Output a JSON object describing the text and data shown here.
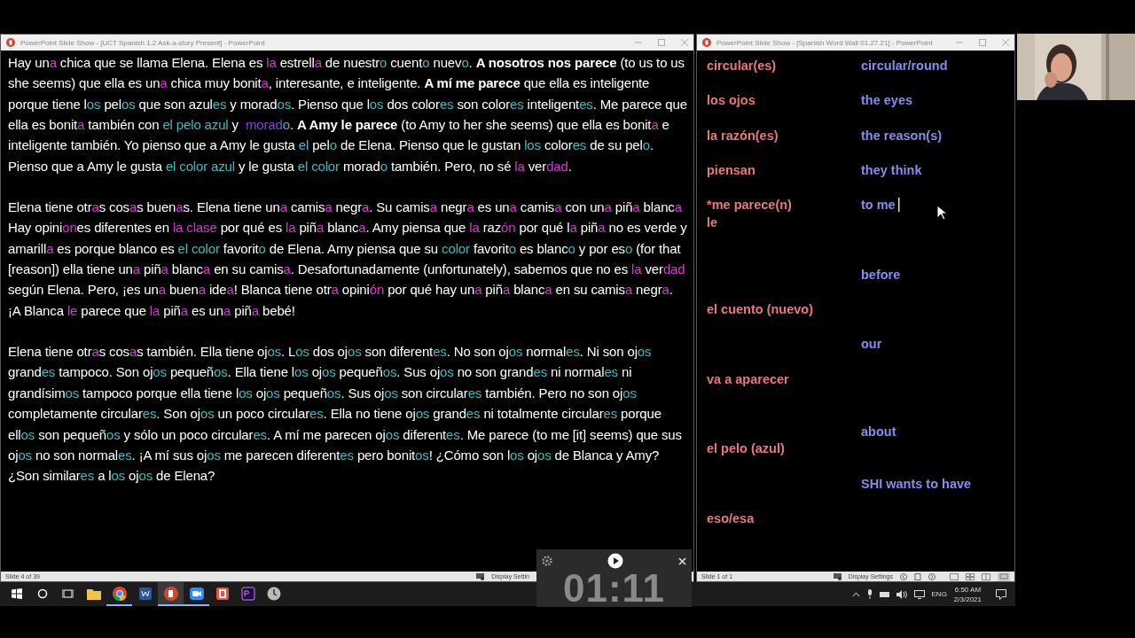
{
  "story_window": {
    "title": "PowerPoint Slide Show - [UCT Spanish 1.2 Ask-a-story Present] - PowerPoint",
    "paragraphs": [
      [
        {
          "text": "Hay un"
        },
        {
          "text": "a",
          "color": "#d63bd0"
        },
        {
          "text": " chica que se llama Elena. Elena es "
        },
        {
          "text": "la",
          "color": "#d63bd0"
        },
        {
          "text": " estrell"
        },
        {
          "text": "a",
          "color": "#d63bd0"
        },
        {
          "text": " de nuestr"
        },
        {
          "text": "o",
          "color": "#3fbcc0"
        },
        {
          "text": " cuent"
        },
        {
          "text": "o",
          "color": "#3fbcc0"
        },
        {
          "text": " nuev"
        },
        {
          "text": "o",
          "color": "#3fbcc0"
        },
        {
          "text": ". **A nosotros nos parece** (to us to us she seems) que ella es un"
        },
        {
          "text": "a",
          "color": "#d63bd0"
        },
        {
          "text": " chica muy bonit"
        },
        {
          "text": "a",
          "color": "#d63bd0"
        },
        {
          "text": ", interesante, e inteligente. **A mí me parece** que ella es inteligente porque tiene l"
        },
        {
          "text": "os",
          "color": "#3fbcc0"
        },
        {
          "text": " pel"
        },
        {
          "text": "os",
          "color": "#3fbcc0"
        },
        {
          "text": " que son azul"
        },
        {
          "text": "es",
          "color": "#3fbcc0"
        },
        {
          "text": " y morad"
        },
        {
          "text": "os",
          "color": "#3fbcc0"
        },
        {
          "text": ". Pienso que l"
        },
        {
          "text": "os",
          "color": "#3fbcc0"
        },
        {
          "text": " dos color"
        },
        {
          "text": "es",
          "color": "#3fbcc0"
        },
        {
          "text": " son color"
        },
        {
          "text": "es",
          "color": "#3fbcc0"
        },
        {
          "text": " inteligent"
        },
        {
          "text": "es",
          "color": "#3fbcc0"
        },
        {
          "text": ". Me parece que ella es bonit"
        },
        {
          "text": "a",
          "color": "#d63bd0"
        },
        {
          "text": " también con "
        },
        {
          "text": "el pelo azul",
          "color": "#3fbcc0"
        },
        {
          "text": " y  "
        },
        {
          "text": "morad",
          "color": "#8b3fe0"
        },
        {
          "text": "o",
          "color": "#3fbcc0"
        },
        {
          "text": ". **A Amy le parece** (to Amy to her she seems) que ella es bonit"
        },
        {
          "text": "a",
          "color": "#d63bd0"
        },
        {
          "text": " e inteligente también. Yo pienso que a Amy le gusta "
        },
        {
          "text": "el",
          "color": "#3fbcc0"
        },
        {
          "text": " pel"
        },
        {
          "text": "o",
          "color": "#3fbcc0"
        },
        {
          "text": " de Elena. Pienso que le gustan "
        },
        {
          "text": "los",
          "color": "#3fbcc0"
        },
        {
          "text": " color"
        },
        {
          "text": "es",
          "color": "#3fbcc0"
        },
        {
          "text": " de su pel"
        },
        {
          "text": "o",
          "color": "#3fbcc0"
        },
        {
          "text": ". Pienso que a Amy le gusta "
        },
        {
          "text": "el color azul",
          "color": "#3fbcc0"
        },
        {
          "text": " y le gusta "
        },
        {
          "text": "el color",
          "color": "#3fbcc0"
        },
        {
          "text": " morad"
        },
        {
          "text": "o",
          "color": "#3fbcc0"
        },
        {
          "text": " también. Pero, no sé "
        },
        {
          "text": "la",
          "color": "#d63bd0"
        },
        {
          "text": " ver"
        },
        {
          "text": "dad",
          "color": "#d63bd0"
        },
        {
          "text": "."
        }
      ],
      [
        {
          "text": "Elena tiene otr"
        },
        {
          "text": "a",
          "color": "#d63bd0"
        },
        {
          "text": "s cos"
        },
        {
          "text": "a",
          "color": "#d63bd0"
        },
        {
          "text": "s buen"
        },
        {
          "text": "a",
          "color": "#d63bd0"
        },
        {
          "text": "s. Elena tiene un"
        },
        {
          "text": "a",
          "color": "#d63bd0"
        },
        {
          "text": " camis"
        },
        {
          "text": "a",
          "color": "#d63bd0"
        },
        {
          "text": " negr"
        },
        {
          "text": "a",
          "color": "#d63bd0"
        },
        {
          "text": ". Su camis"
        },
        {
          "text": "a",
          "color": "#d63bd0"
        },
        {
          "text": " negr"
        },
        {
          "text": "a",
          "color": "#d63bd0"
        },
        {
          "text": " es un"
        },
        {
          "text": "a",
          "color": "#d63bd0"
        },
        {
          "text": " camis"
        },
        {
          "text": "a",
          "color": "#d63bd0"
        },
        {
          "text": " con un"
        },
        {
          "text": "a",
          "color": "#d63bd0"
        },
        {
          "text": " piñ"
        },
        {
          "text": "a",
          "color": "#d63bd0"
        },
        {
          "text": " blanc"
        },
        {
          "text": "a",
          "color": "#d63bd0"
        },
        {
          "text": " Hay opini"
        },
        {
          "text": "on",
          "color": "#d63bd0"
        },
        {
          "text": "es diferentes en "
        },
        {
          "text": "la clase",
          "color": "#d63bd0"
        },
        {
          "text": " por qué es "
        },
        {
          "text": "la",
          "color": "#d63bd0"
        },
        {
          "text": " piñ"
        },
        {
          "text": "a",
          "color": "#d63bd0"
        },
        {
          "text": " blanc"
        },
        {
          "text": "a",
          "color": "#d63bd0"
        },
        {
          "text": ". Amy piensa que "
        },
        {
          "text": "la",
          "color": "#d63bd0"
        },
        {
          "text": " raz"
        },
        {
          "text": "ón",
          "color": "#d63bd0"
        },
        {
          "text": " por qué l"
        },
        {
          "text": "a",
          "color": "#d63bd0"
        },
        {
          "text": " piñ"
        },
        {
          "text": "a",
          "color": "#d63bd0"
        },
        {
          "text": " no es verde y amarill"
        },
        {
          "text": "a",
          "color": "#d63bd0"
        },
        {
          "text": " es porque blanco es "
        },
        {
          "text": "el color",
          "color": "#3fbcc0"
        },
        {
          "text": " favorit"
        },
        {
          "text": "o",
          "color": "#3fbcc0"
        },
        {
          "text": " de Elena. Amy piensa que su "
        },
        {
          "text": "color",
          "color": "#3fbcc0"
        },
        {
          "text": " favorit"
        },
        {
          "text": "o",
          "color": "#3fbcc0"
        },
        {
          "text": " es blanc"
        },
        {
          "text": "o",
          "color": "#3fbcc0"
        },
        {
          "text": " y por es"
        },
        {
          "text": "o",
          "color": "#3fbcc0"
        },
        {
          "text": " (for that [reason]) ella tiene un"
        },
        {
          "text": "a",
          "color": "#d63bd0"
        },
        {
          "text": " piñ"
        },
        {
          "text": "a",
          "color": "#d63bd0"
        },
        {
          "text": " blanc"
        },
        {
          "text": "a",
          "color": "#d63bd0"
        },
        {
          "text": " en su camis"
        },
        {
          "text": "a",
          "color": "#d63bd0"
        },
        {
          "text": ". Desafortunadamente (unfortunately), sabemos que no es "
        },
        {
          "text": "la",
          "color": "#d63bd0"
        },
        {
          "text": " ver"
        },
        {
          "text": "dad",
          "color": "#d63bd0"
        },
        {
          "text": " según Elena. Pero, ¡es un"
        },
        {
          "text": "a",
          "color": "#d63bd0"
        },
        {
          "text": " buen"
        },
        {
          "text": "a",
          "color": "#d63bd0"
        },
        {
          "text": " ide"
        },
        {
          "text": "a",
          "color": "#d63bd0"
        },
        {
          "text": "! Blanca tiene otr"
        },
        {
          "text": "a",
          "color": "#d63bd0"
        },
        {
          "text": " opini"
        },
        {
          "text": "ón",
          "color": "#d63bd0"
        },
        {
          "text": " por qué hay un"
        },
        {
          "text": "a",
          "color": "#d63bd0"
        },
        {
          "text": " piñ"
        },
        {
          "text": "a",
          "color": "#d63bd0"
        },
        {
          "text": " blanc"
        },
        {
          "text": "a",
          "color": "#d63bd0"
        },
        {
          "text": " en su camis"
        },
        {
          "text": "a",
          "color": "#d63bd0"
        },
        {
          "text": " negr"
        },
        {
          "text": "a",
          "color": "#d63bd0"
        },
        {
          "text": ". ¡A Blanca "
        },
        {
          "text": "le",
          "color": "#d63bd0"
        },
        {
          "text": " parece que "
        },
        {
          "text": "la",
          "color": "#d63bd0"
        },
        {
          "text": " piñ"
        },
        {
          "text": "a",
          "color": "#d63bd0"
        },
        {
          "text": " es un"
        },
        {
          "text": "a",
          "color": "#d63bd0"
        },
        {
          "text": " piñ"
        },
        {
          "text": "a",
          "color": "#d63bd0"
        },
        {
          "text": " bebé!"
        }
      ],
      [
        {
          "text": "Elena tiene otr"
        },
        {
          "text": "a",
          "color": "#d63bd0"
        },
        {
          "text": "s cos"
        },
        {
          "text": "a",
          "color": "#d63bd0"
        },
        {
          "text": "s también. Ella tiene oj"
        },
        {
          "text": "os",
          "color": "#3fbcc0"
        },
        {
          "text": ". L"
        },
        {
          "text": "os",
          "color": "#3fbcc0"
        },
        {
          "text": " dos oj"
        },
        {
          "text": "os",
          "color": "#3fbcc0"
        },
        {
          "text": " son diferent"
        },
        {
          "text": "es",
          "color": "#3fbcc0"
        },
        {
          "text": ". No son oj"
        },
        {
          "text": "os",
          "color": "#3fbcc0"
        },
        {
          "text": " normal"
        },
        {
          "text": "es",
          "color": "#3fbcc0"
        },
        {
          "text": ". Ni son oj"
        },
        {
          "text": "os",
          "color": "#3fbcc0"
        },
        {
          "text": " grand"
        },
        {
          "text": "es",
          "color": "#3fbcc0"
        },
        {
          "text": " tampoco. Son oj"
        },
        {
          "text": "os",
          "color": "#3fbcc0"
        },
        {
          "text": " pequeñ"
        },
        {
          "text": "os",
          "color": "#3fbcc0"
        },
        {
          "text": ". Ella tiene l"
        },
        {
          "text": "os",
          "color": "#3fbcc0"
        },
        {
          "text": " oj"
        },
        {
          "text": "os",
          "color": "#3fbcc0"
        },
        {
          "text": " pequeñ"
        },
        {
          "text": "os",
          "color": "#3fbcc0"
        },
        {
          "text": ". Sus oj"
        },
        {
          "text": "os",
          "color": "#3fbcc0"
        },
        {
          "text": " no son grand"
        },
        {
          "text": "es",
          "color": "#3fbcc0"
        },
        {
          "text": " ni normal"
        },
        {
          "text": "es",
          "color": "#3fbcc0"
        },
        {
          "text": " ni grandísim"
        },
        {
          "text": "os",
          "color": "#3fbcc0"
        },
        {
          "text": " tampoco porque ella tiene l"
        },
        {
          "text": "os",
          "color": "#3fbcc0"
        },
        {
          "text": " oj"
        },
        {
          "text": "os",
          "color": "#3fbcc0"
        },
        {
          "text": " pequeñ"
        },
        {
          "text": "os",
          "color": "#3fbcc0"
        },
        {
          "text": ". Sus oj"
        },
        {
          "text": "os",
          "color": "#3fbcc0"
        },
        {
          "text": " son circular"
        },
        {
          "text": "es",
          "color": "#3fbcc0"
        },
        {
          "text": " también. Pero no son oj"
        },
        {
          "text": "os",
          "color": "#3fbcc0"
        },
        {
          "text": " completamente circular"
        },
        {
          "text": "es",
          "color": "#3fbcc0"
        },
        {
          "text": ". Son oj"
        },
        {
          "text": "os",
          "color": "#3fbcc0"
        },
        {
          "text": " un poco circular"
        },
        {
          "text": "es",
          "color": "#3fbcc0"
        },
        {
          "text": ". Ella no tiene oj"
        },
        {
          "text": "os",
          "color": "#3fbcc0"
        },
        {
          "text": " grand"
        },
        {
          "text": "es",
          "color": "#3fbcc0"
        },
        {
          "text": " ni totalmente circular"
        },
        {
          "text": "es",
          "color": "#3fbcc0"
        },
        {
          "text": " porque ell"
        },
        {
          "text": "os",
          "color": "#3fbcc0"
        },
        {
          "text": " son pequeñ"
        },
        {
          "text": "os",
          "color": "#3fbcc0"
        },
        {
          "text": " y sólo un poco circular"
        },
        {
          "text": "es",
          "color": "#3fbcc0"
        },
        {
          "text": ". A mí me parecen oj"
        },
        {
          "text": "os",
          "color": "#3fbcc0"
        },
        {
          "text": " diferent"
        },
        {
          "text": "es",
          "color": "#3fbcc0"
        },
        {
          "text": ". Me parece (to me [it] seems) que sus oj"
        },
        {
          "text": "os",
          "color": "#3fbcc0"
        },
        {
          "text": " no son normal"
        },
        {
          "text": "es",
          "color": "#3fbcc0"
        },
        {
          "text": ". ¡A mí sus oj"
        },
        {
          "text": "os",
          "color": "#3fbcc0"
        },
        {
          "text": " me parecen diferent"
        },
        {
          "text": "es",
          "color": "#3fbcc0"
        },
        {
          "text": " pero bonit"
        },
        {
          "text": "os",
          "color": "#3fbcc0"
        },
        {
          "text": "! ¿Cómo son l"
        },
        {
          "text": "os",
          "color": "#3fbcc0"
        },
        {
          "text": " oj"
        },
        {
          "text": "os",
          "color": "#3fbcc0"
        },
        {
          "text": " de Blanca y Amy? ¿Son similar"
        },
        {
          "text": "es",
          "color": "#3fbcc0"
        },
        {
          "text": " a l"
        },
        {
          "text": "os",
          "color": "#3fbcc0"
        },
        {
          "text": " oj"
        },
        {
          "text": "os",
          "color": "#3fbcc0"
        },
        {
          "text": " de Elena?"
        }
      ]
    ],
    "status_bar": {
      "slide_counter": "Slide 4 of 39",
      "display_settings": "Display Settin"
    }
  },
  "word_wall_window": {
    "title": "PowerPoint Slide Show - [Spanish Word Wall 01.27.21] - PowerPoint",
    "rows": [
      {
        "spanish": [
          "circular(es)"
        ],
        "english": "circular/round",
        "editing": false
      },
      {
        "spanish": [
          "los ojos"
        ],
        "english": "the eyes",
        "editing": false
      },
      {
        "spanish": [
          "la razón(es)"
        ],
        "english": "the reason(s)",
        "editing": false
      },
      {
        "spanish": [
          "piensan"
        ],
        "english": "they think",
        "editing": false
      },
      {
        "spanish": [
          "*me parece(n)",
          "le"
        ],
        "english": "to me",
        "editing": true
      },
      {
        "english": "before",
        "editing": false
      },
      {
        "spanish": [
          "el cuento (nuevo)"
        ],
        "editing": false
      },
      {
        "english": "our",
        "editing": false
      },
      {
        "spanish": [
          "va a aparecer"
        ],
        "editing": false
      },
      {
        "english": "about",
        "editing": false
      },
      {
        "spanish": [
          "el pelo (azul)"
        ],
        "editing": false
      },
      {
        "english": "SHI wants to have",
        "editing": false
      },
      {
        "spanish": [
          "eso/esa"
        ],
        "editing": false
      }
    ],
    "status_bar": {
      "slide_counter": "Slide 1 of 1",
      "display_settings": "Display Settings"
    }
  },
  "timer": {
    "time": "01:11"
  },
  "taskbar": {
    "apps": [
      {
        "kind": "explorer",
        "running": false,
        "selected": false
      },
      {
        "kind": "chrome",
        "running": true,
        "selected": false
      },
      {
        "kind": "word",
        "running": false,
        "selected": false
      },
      {
        "kind": "powerpoint",
        "running": true,
        "selected": true
      },
      {
        "kind": "zoom",
        "running": true,
        "selected": false
      },
      {
        "kind": "recorder",
        "running": false,
        "selected": false
      },
      {
        "kind": "premiere",
        "running": false,
        "selected": false
      },
      {
        "kind": "clock",
        "running": false,
        "selected": false
      }
    ],
    "tray": {
      "language": "ENG",
      "time": "6:50 AM",
      "date": "2/3/2021"
    }
  }
}
